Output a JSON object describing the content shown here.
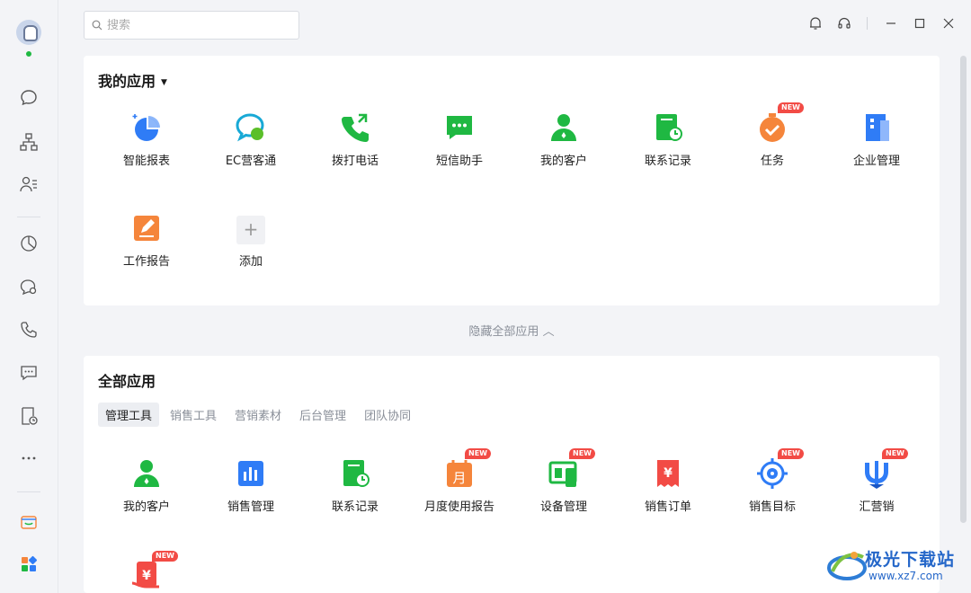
{
  "search": {
    "placeholder": "搜索"
  },
  "my_apps": {
    "title": "我的应用",
    "items": [
      {
        "label": "智能报表"
      },
      {
        "label": "EC营客通"
      },
      {
        "label": "拨打电话"
      },
      {
        "label": "短信助手"
      },
      {
        "label": "我的客户"
      },
      {
        "label": "联系记录"
      },
      {
        "label": "任务",
        "badge": "NEW"
      },
      {
        "label": "企业管理"
      },
      {
        "label": "工作报告"
      },
      {
        "label": "添加"
      }
    ]
  },
  "hide_all_label": "隐藏全部应用",
  "all_apps": {
    "title": "全部应用",
    "tabs": [
      "管理工具",
      "销售工具",
      "营销素材",
      "后台管理",
      "团队协同"
    ],
    "active_tab": "管理工具",
    "items": [
      {
        "label": "我的客户"
      },
      {
        "label": "销售管理"
      },
      {
        "label": "联系记录"
      },
      {
        "label": "月度使用报告",
        "badge": "NEW"
      },
      {
        "label": "设备管理",
        "badge": "NEW"
      },
      {
        "label": "销售订单"
      },
      {
        "label": "销售目标",
        "badge": "NEW"
      },
      {
        "label": "汇营销",
        "badge": "NEW"
      }
    ],
    "extra_badge": "NEW"
  },
  "watermark": {
    "title": "极光下载站",
    "url": "www.xz7.com"
  },
  "colors": {
    "green": "#1fb842",
    "blue": "#2f7cf6",
    "orange": "#f5853b",
    "red": "#f24b45"
  }
}
